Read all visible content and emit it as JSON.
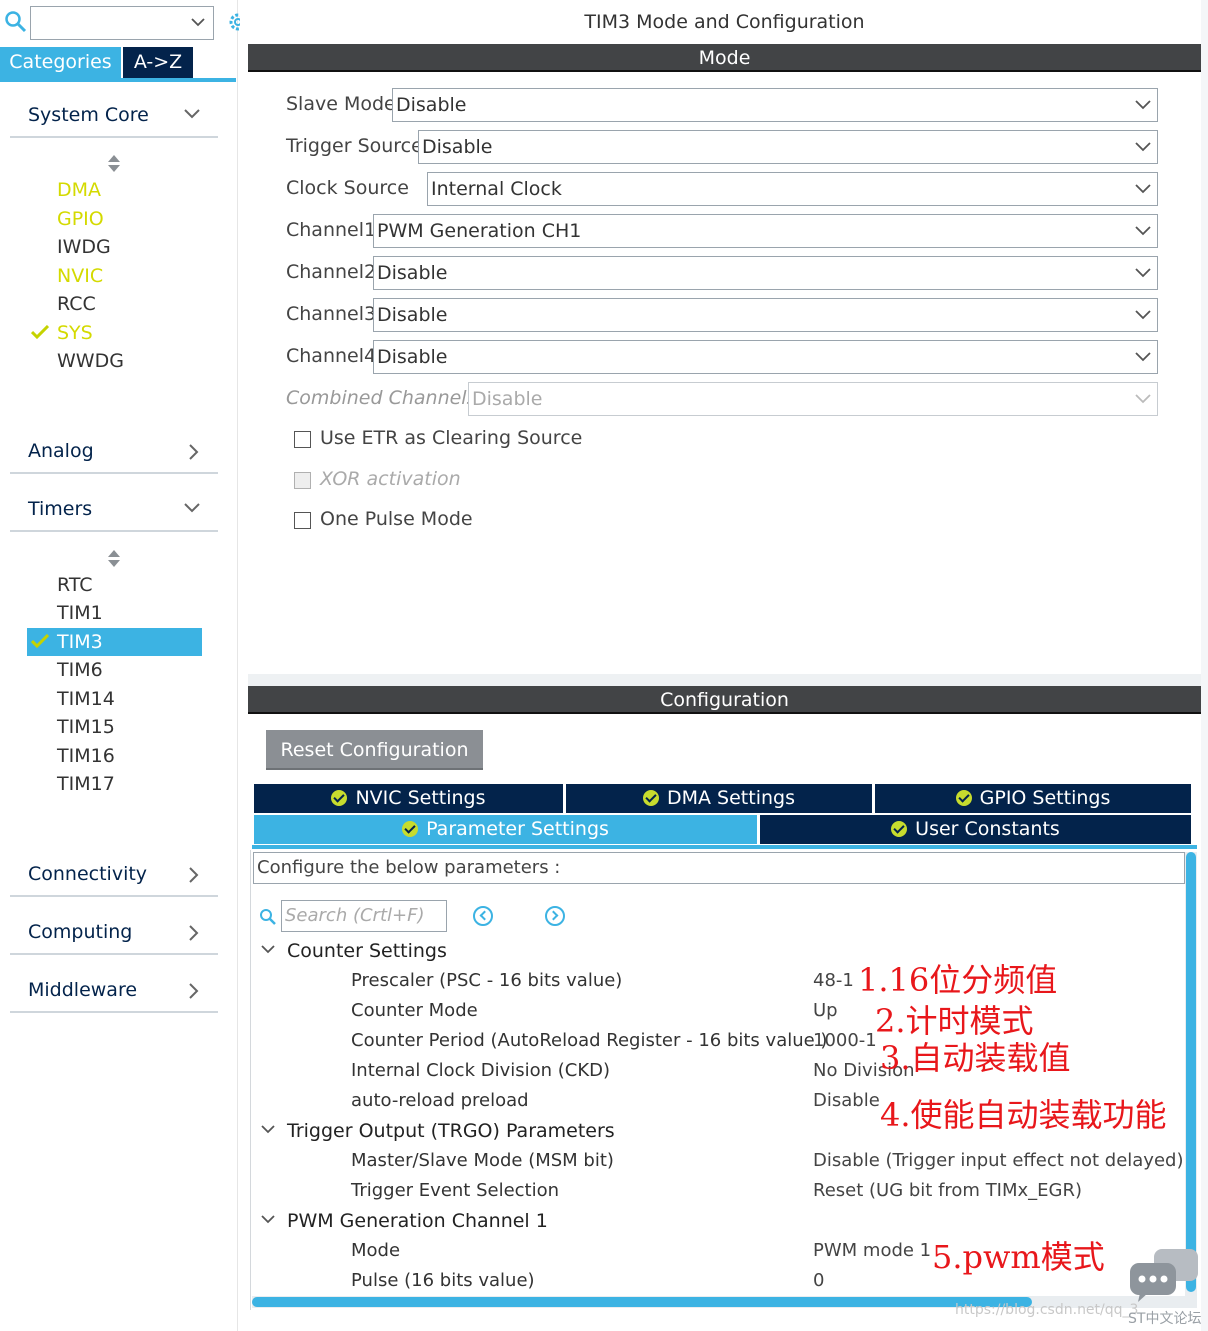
{
  "left_panel": {
    "tabs": {
      "categories": "Categories",
      "az": "A->Z"
    },
    "categories": [
      {
        "label": "System Core",
        "expanded": true
      },
      {
        "label": "Analog",
        "expanded": false
      },
      {
        "label": "Timers",
        "expanded": true
      },
      {
        "label": "Connectivity",
        "expanded": false
      },
      {
        "label": "Computing",
        "expanded": false
      },
      {
        "label": "Middleware",
        "expanded": false
      }
    ],
    "system_core_items": [
      {
        "label": "DMA",
        "status": "warning"
      },
      {
        "label": "GPIO",
        "status": "warning"
      },
      {
        "label": "IWDG",
        "status": "none"
      },
      {
        "label": "NVIC",
        "status": "warning"
      },
      {
        "label": "RCC",
        "status": "none"
      },
      {
        "label": "SYS",
        "status": "ok"
      },
      {
        "label": "WWDG",
        "status": "none"
      }
    ],
    "timer_items": [
      {
        "label": "RTC",
        "status": "none"
      },
      {
        "label": "TIM1",
        "status": "none"
      },
      {
        "label": "TIM3",
        "status": "ok",
        "selected": true
      },
      {
        "label": "TIM6",
        "status": "none"
      },
      {
        "label": "TIM14",
        "status": "none"
      },
      {
        "label": "TIM15",
        "status": "none"
      },
      {
        "label": "TIM16",
        "status": "none"
      },
      {
        "label": "TIM17",
        "status": "none"
      }
    ]
  },
  "mode_panel": {
    "title": "TIM3 Mode and Configuration",
    "section_label": "Mode",
    "fields": [
      {
        "label": "Slave Mode",
        "value": "Disable"
      },
      {
        "label": "Trigger Source",
        "value": "Disable"
      },
      {
        "label": "Clock Source",
        "value": "Internal Clock"
      },
      {
        "label": "Channel1",
        "value": "PWM Generation CH1"
      },
      {
        "label": "Channel2",
        "value": "Disable"
      },
      {
        "label": "Channel3",
        "value": "Disable"
      },
      {
        "label": "Channel4",
        "value": "Disable"
      },
      {
        "label": "Combined Channels",
        "value": "Disable",
        "disabled": true
      }
    ],
    "checkboxes": [
      {
        "label": "Use ETR as Clearing Source",
        "checked": false
      },
      {
        "label": "XOR activation",
        "checked": false,
        "disabled": true
      },
      {
        "label": "One Pulse Mode",
        "checked": false
      }
    ]
  },
  "config_panel": {
    "section_label": "Configuration",
    "reset_button": "Reset Configuration",
    "tabs_row1": [
      "NVIC Settings",
      "DMA Settings",
      "GPIO Settings"
    ],
    "tabs_row2": [
      "Parameter Settings",
      "User Constants"
    ],
    "active_tab": "Parameter Settings",
    "configure_hint": "Configure the below parameters :",
    "search_placeholder": "Search (Crtl+F)",
    "groups": [
      {
        "label": "Counter Settings",
        "items": [
          {
            "name": "Prescaler (PSC - 16 bits value)",
            "value": "48-1"
          },
          {
            "name": "Counter Mode",
            "value": "Up"
          },
          {
            "name": "Counter Period (AutoReload Register - 16 bits value )",
            "value": "1000-1"
          },
          {
            "name": "Internal Clock Division (CKD)",
            "value": "No Division"
          },
          {
            "name": "auto-reload preload",
            "value": "Disable"
          }
        ]
      },
      {
        "label": "Trigger Output (TRGO) Parameters",
        "items": [
          {
            "name": "Master/Slave Mode (MSM bit)",
            "value": "Disable (Trigger input effect not delayed)"
          },
          {
            "name": "Trigger Event Selection",
            "value": "Reset (UG bit from TIMx_EGR)"
          }
        ]
      },
      {
        "label": "PWM Generation Channel 1",
        "items": [
          {
            "name": "Mode",
            "value": "PWM mode 1"
          },
          {
            "name": "Pulse (16 bits value)",
            "value": "0"
          }
        ]
      }
    ]
  },
  "annotations": [
    "1.16位分频值",
    "2.计时模式",
    "3.自动装载值",
    "4.使能自动装载功能",
    "5.pwm模式"
  ],
  "watermark": "https://blog.csdn.net/qq_3",
  "forum_label": "ST中文论坛",
  "colors": {
    "accent": "#3cb3e3",
    "navy": "#03234b",
    "warning": "#d4da00",
    "annotation": "#e8171b",
    "section_bar": "#424446"
  }
}
